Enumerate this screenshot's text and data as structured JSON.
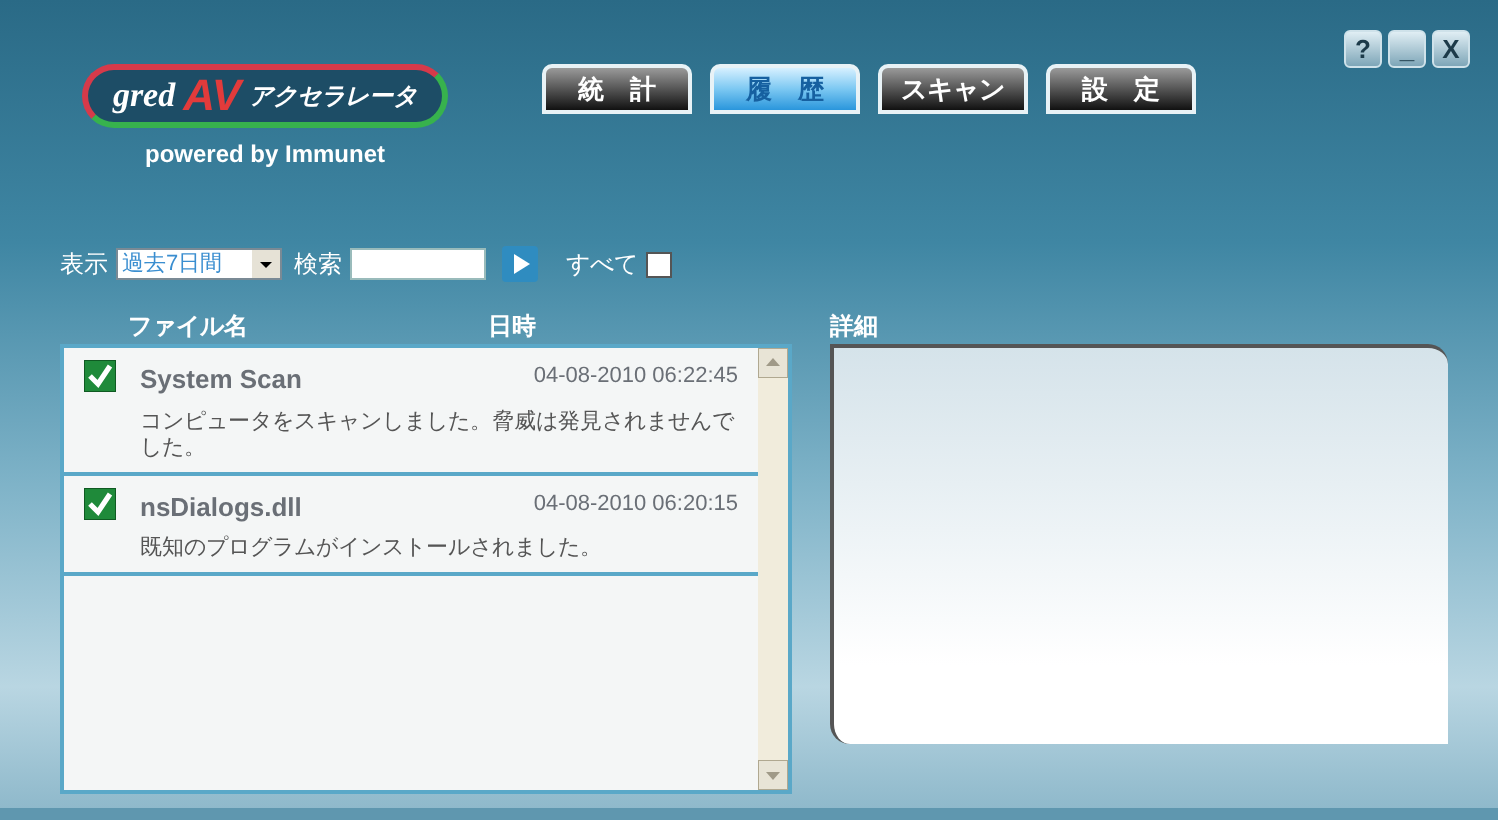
{
  "logo": {
    "brand": "gred",
    "mark": "AV",
    "product": "アクセラレータ",
    "tagline": "powered by Immunet"
  },
  "tabs": [
    {
      "label": "統　計",
      "selected": false
    },
    {
      "label": "履　歴",
      "selected": true
    },
    {
      "label": "スキャン",
      "selected": false
    },
    {
      "label": "設　定",
      "selected": false
    }
  ],
  "window_controls": [
    "?",
    "_",
    "X"
  ],
  "filter": {
    "label": "表示",
    "dropdown_value": "過去7日間",
    "search_label": "検索",
    "all_label": "すべて",
    "all_checked": false
  },
  "list": {
    "columns": [
      "ファイル名",
      "日時"
    ],
    "rows": [
      {
        "name": "System Scan",
        "datetime": "04-08-2010 06:22:45",
        "description": "コンピュータをスキャンしました。脅威は発見されませんでした。",
        "checked": true
      },
      {
        "name": "nsDialogs.dll",
        "datetime": "04-08-2010 06:20:15",
        "description": "既知のプログラムがインストールされました。",
        "checked": true
      }
    ]
  },
  "details": {
    "label": "詳細"
  }
}
